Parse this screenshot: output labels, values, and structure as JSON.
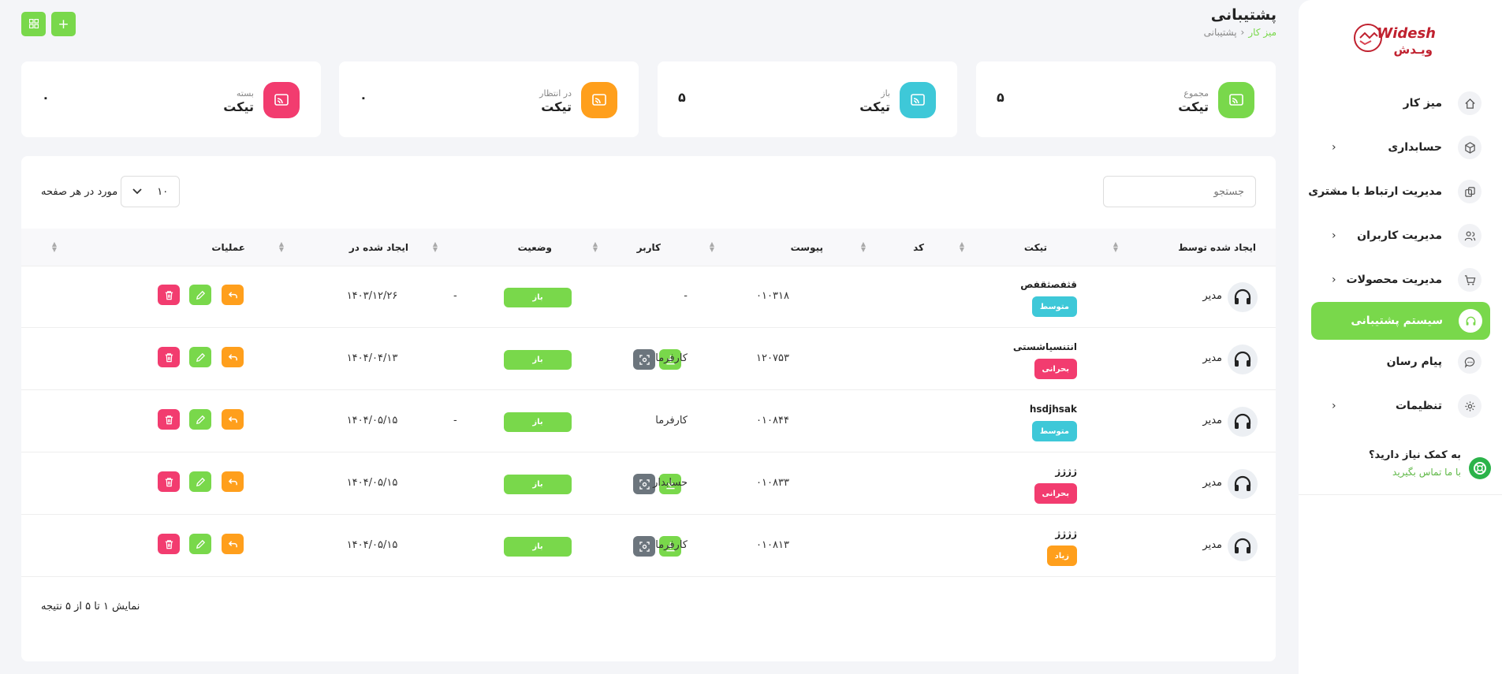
{
  "brand": {
    "name_en": "Widesh",
    "name_fa": "ویـدش"
  },
  "header": {
    "title": "پشتیبانی",
    "breadcrumb": {
      "home": "میز کار",
      "current": "پشتیبانی"
    }
  },
  "sidebar": {
    "items": [
      {
        "label": "میز کار",
        "icon": "home-icon"
      },
      {
        "label": "حسابداری",
        "icon": "box-icon"
      },
      {
        "label": "مدیریت ارتباط با مشتری",
        "icon": "copy-icon"
      },
      {
        "label": "مدیریت کاربران",
        "icon": "users-icon"
      },
      {
        "label": "مدیریت محصولات",
        "icon": "cart-icon"
      },
      {
        "label": "سیستم پشتیبانی",
        "icon": "headset-icon"
      },
      {
        "label": "پیام رسان",
        "icon": "chat-icon"
      },
      {
        "label": "تنظیمات",
        "icon": "gear-icon"
      }
    ],
    "active": "سیستم پشتیبانی",
    "help": {
      "title": "به کمک نیاز دارید؟",
      "link": "با ما تماس بگیرید"
    }
  },
  "top_buttons": {
    "add": "+",
    "grid_icon": "grid-icon"
  },
  "stats": [
    {
      "small": "مجموع",
      "label": "تیکت",
      "value": "۵",
      "color": "#79d84b"
    },
    {
      "small": "باز",
      "label": "تیکت",
      "value": "۵",
      "color": "#3ec8d8"
    },
    {
      "small": "در انتظار",
      "label": "تیکت",
      "value": "۰",
      "color": "#ff9f1c"
    },
    {
      "small": "بسته",
      "label": "تیکت",
      "value": "۰",
      "color": "#f23c6f"
    }
  ],
  "table": {
    "search_placeholder": "جستجو",
    "per_page_value": "۱۰",
    "per_page_label": "مورد در هر صفحه",
    "columns": {
      "creator": "ایجاد شده توسط",
      "ticket": "تیکت",
      "code": "کد",
      "attachment": "پیوست",
      "user": "کاربر",
      "status": "وضعیت",
      "created_at": "ایجاد شده در",
      "actions": "عملیات"
    },
    "rows": [
      {
        "creator": "مدیر",
        "title": "قثفصثقفص",
        "priority": "متوسط",
        "priority_color": "#3ec8d8",
        "code": "۰۱۰۳۱۸",
        "attachment": "-",
        "user": "-",
        "status": "باز",
        "date": "۱۴۰۳/۱۲/۲۶"
      },
      {
        "creator": "مدیر",
        "title": "انتنسیاشستی",
        "priority": "بحرانی",
        "priority_color": "#f23c6f",
        "code": "۱۲۰۷۵۳",
        "attachment": "files",
        "user": "کارفرما",
        "status": "باز",
        "date": "۱۴۰۴/۰۴/۱۳"
      },
      {
        "creator": "مدیر",
        "title": "hsdjhsak",
        "priority": "متوسط",
        "priority_color": "#3ec8d8",
        "code": "۰۱۰۸۴۴",
        "attachment": "-",
        "user": "کارفرما",
        "status": "باز",
        "date": "۱۴۰۴/۰۵/۱۵"
      },
      {
        "creator": "مدیر",
        "title": "ژژژژ",
        "priority": "بحرانی",
        "priority_color": "#f23c6f",
        "code": "۰۱۰۸۳۳",
        "attachment": "files",
        "user": "حسابدار",
        "status": "باز",
        "date": "۱۴۰۴/۰۵/۱۵"
      },
      {
        "creator": "مدیر",
        "title": "ژژژژ",
        "priority": "زیاد",
        "priority_color": "#ff9f1c",
        "code": "۰۱۰۸۱۳",
        "attachment": "files",
        "user": "کارفرما",
        "status": "باز",
        "date": "۱۴۰۴/۰۵/۱۵"
      }
    ],
    "footer": "نمایش ۱ تا ۵ از ۵ نتیجه"
  },
  "colors": {
    "accent": "#79d84b",
    "reply": "#ff9f1c",
    "delete": "#f23c6f",
    "gray_button": "#6c757d"
  }
}
